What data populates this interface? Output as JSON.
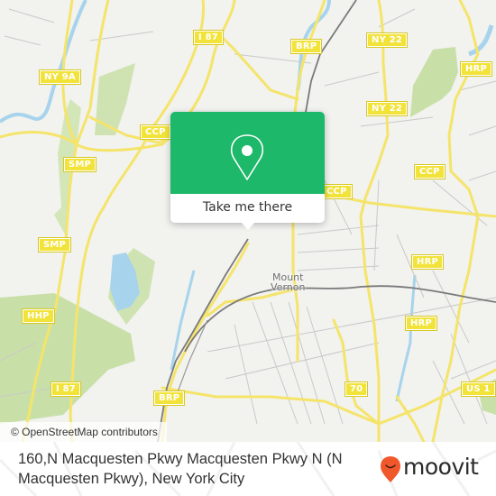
{
  "map": {
    "colors": {
      "background": "#f2f2ef",
      "road_major": "#f5e46a",
      "road_minor": "#c9c9c9",
      "rail": "#7a7a7a",
      "water": "#a7d4ec",
      "park": "#c8e0a8",
      "shield": "#f2e33a"
    },
    "road_labels": {
      "i87_top": "I 87",
      "brp_top": "BRP",
      "ny22_top": "NY 22",
      "ny9a": "NY 9A",
      "hrp_top": "HRP",
      "ny22_mid": "NY 22",
      "ccp_left": "CCP",
      "smp_top": "SMP",
      "ccp_right": "CCP",
      "ccp_center": "CCP",
      "smp_lower": "SMP",
      "hrp_mid": "HRP",
      "hhp": "HHP",
      "hrp_lower": "HRP",
      "i87_bottom": "I 87",
      "route_70": "70",
      "us1": "US 1",
      "brp_bottom": "BRP"
    },
    "place_labels": {
      "city": "Mount\nVernon",
      "city_line1": "Mount",
      "city_line2": "Vernon"
    },
    "attribution": "© OpenStreetMap contributors"
  },
  "popup": {
    "icon": "map-pin-icon",
    "accent_color": "#1eb86a",
    "button_label": "Take me there"
  },
  "footer": {
    "address": "160,N Macquesten Pkwy Macquesten Pkwy N (N Macquesten Pkwy), New York City",
    "brand": {
      "name": "moovit",
      "icon": "moovit-pin-logo-icon",
      "color": "#f0582c"
    }
  }
}
